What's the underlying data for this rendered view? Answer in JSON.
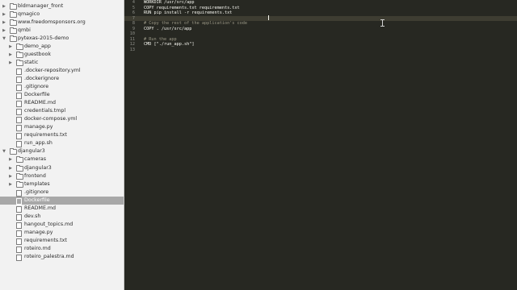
{
  "sidebar": {
    "items": [
      {
        "label": "bldmanager_front",
        "type": "folder",
        "level": 0,
        "expanded": false,
        "icon": "folder-icon"
      },
      {
        "label": "qmagico",
        "type": "folder",
        "level": 0,
        "expanded": false,
        "icon": "folder-icon"
      },
      {
        "label": "www.freedomsponsors.org",
        "type": "folder",
        "level": 0,
        "expanded": false,
        "icon": "folder-icon"
      },
      {
        "label": "qmbi",
        "type": "folder",
        "level": 0,
        "expanded": false,
        "icon": "folder-icon"
      },
      {
        "label": "pytexas-2015-demo",
        "type": "folder",
        "level": 0,
        "expanded": true,
        "icon": "folder-open-icon"
      },
      {
        "label": "demo_app",
        "type": "folder",
        "level": 1,
        "expanded": false,
        "icon": "folder-icon"
      },
      {
        "label": "guestbook",
        "type": "folder",
        "level": 1,
        "expanded": false,
        "icon": "folder-icon"
      },
      {
        "label": "static",
        "type": "folder",
        "level": 1,
        "expanded": false,
        "icon": "folder-icon"
      },
      {
        "label": ".docker-repository.yml",
        "type": "file",
        "level": 1,
        "icon": "file-icon"
      },
      {
        "label": ".dockerignore",
        "type": "file",
        "level": 1,
        "icon": "file-icon"
      },
      {
        "label": ".gitignore",
        "type": "file",
        "level": 1,
        "icon": "file-icon"
      },
      {
        "label": "Dockerfile",
        "type": "file",
        "level": 1,
        "icon": "file-icon"
      },
      {
        "label": "README.md",
        "type": "file",
        "level": 1,
        "icon": "file-icon"
      },
      {
        "label": "credentials.tmpl",
        "type": "file",
        "level": 1,
        "icon": "file-icon"
      },
      {
        "label": "docker-compose.yml",
        "type": "file",
        "level": 1,
        "icon": "file-icon"
      },
      {
        "label": "manage.py",
        "type": "file",
        "level": 1,
        "icon": "file-icon"
      },
      {
        "label": "requirements.txt",
        "type": "file",
        "level": 1,
        "icon": "file-icon"
      },
      {
        "label": "run_app.sh",
        "type": "file",
        "level": 1,
        "icon": "file-icon"
      },
      {
        "label": "djangular3",
        "type": "folder",
        "level": 0,
        "expanded": true,
        "icon": "folder-open-icon"
      },
      {
        "label": "cameras",
        "type": "folder",
        "level": 1,
        "expanded": false,
        "icon": "folder-icon"
      },
      {
        "label": "djangular3",
        "type": "folder",
        "level": 1,
        "expanded": false,
        "icon": "folder-icon"
      },
      {
        "label": "frontend",
        "type": "folder",
        "level": 1,
        "expanded": false,
        "icon": "folder-icon"
      },
      {
        "label": "templates",
        "type": "folder",
        "level": 1,
        "expanded": false,
        "icon": "folder-icon"
      },
      {
        "label": ".gitignore",
        "type": "file",
        "level": 1,
        "icon": "file-icon"
      },
      {
        "label": "Dockerfile",
        "type": "file",
        "level": 1,
        "selected": true,
        "icon": "file-icon"
      },
      {
        "label": "README.md",
        "type": "file",
        "level": 1,
        "icon": "file-icon"
      },
      {
        "label": "dev.sh",
        "type": "file",
        "level": 1,
        "icon": "file-icon"
      },
      {
        "label": "hangout_topics.md",
        "type": "file",
        "level": 1,
        "icon": "file-icon"
      },
      {
        "label": "manage.py",
        "type": "file",
        "level": 1,
        "icon": "file-icon"
      },
      {
        "label": "requirements.txt",
        "type": "file",
        "level": 1,
        "icon": "file-icon"
      },
      {
        "label": "roteiro.md",
        "type": "file",
        "level": 1,
        "icon": "file-icon"
      },
      {
        "label": "roteiro_palestra.md",
        "type": "file",
        "level": 1,
        "icon": "file-icon"
      }
    ]
  },
  "editor": {
    "current_line": 7,
    "lines": [
      {
        "num": "4",
        "text": "WORKDIR /usr/src/app",
        "kind": "code"
      },
      {
        "num": "5",
        "text": "COPY requirements.txt requirements.txt",
        "kind": "code"
      },
      {
        "num": "6",
        "text": "RUN pip install -r requirements.txt",
        "kind": "code"
      },
      {
        "num": "7",
        "text": "",
        "kind": "code"
      },
      {
        "num": "8",
        "text": "# Copy the rest of the application's code",
        "kind": "comment"
      },
      {
        "num": "9",
        "text": "COPY . /usr/src/app",
        "kind": "code"
      },
      {
        "num": "10",
        "text": "",
        "kind": "code"
      },
      {
        "num": "11",
        "text": "# Run the app",
        "kind": "comment"
      },
      {
        "num": "12",
        "text": "CMD [\"./run_app.sh\"]",
        "kind": "code"
      },
      {
        "num": "13",
        "text": "",
        "kind": "code"
      }
    ]
  },
  "colors": {
    "sidebar_bg": "#f2f2f2",
    "selection": "#a8a8a8",
    "editor_bg": "#272822",
    "editor_text": "#f8f8f2",
    "comment": "#9a9785",
    "line_number": "#8f908a"
  }
}
